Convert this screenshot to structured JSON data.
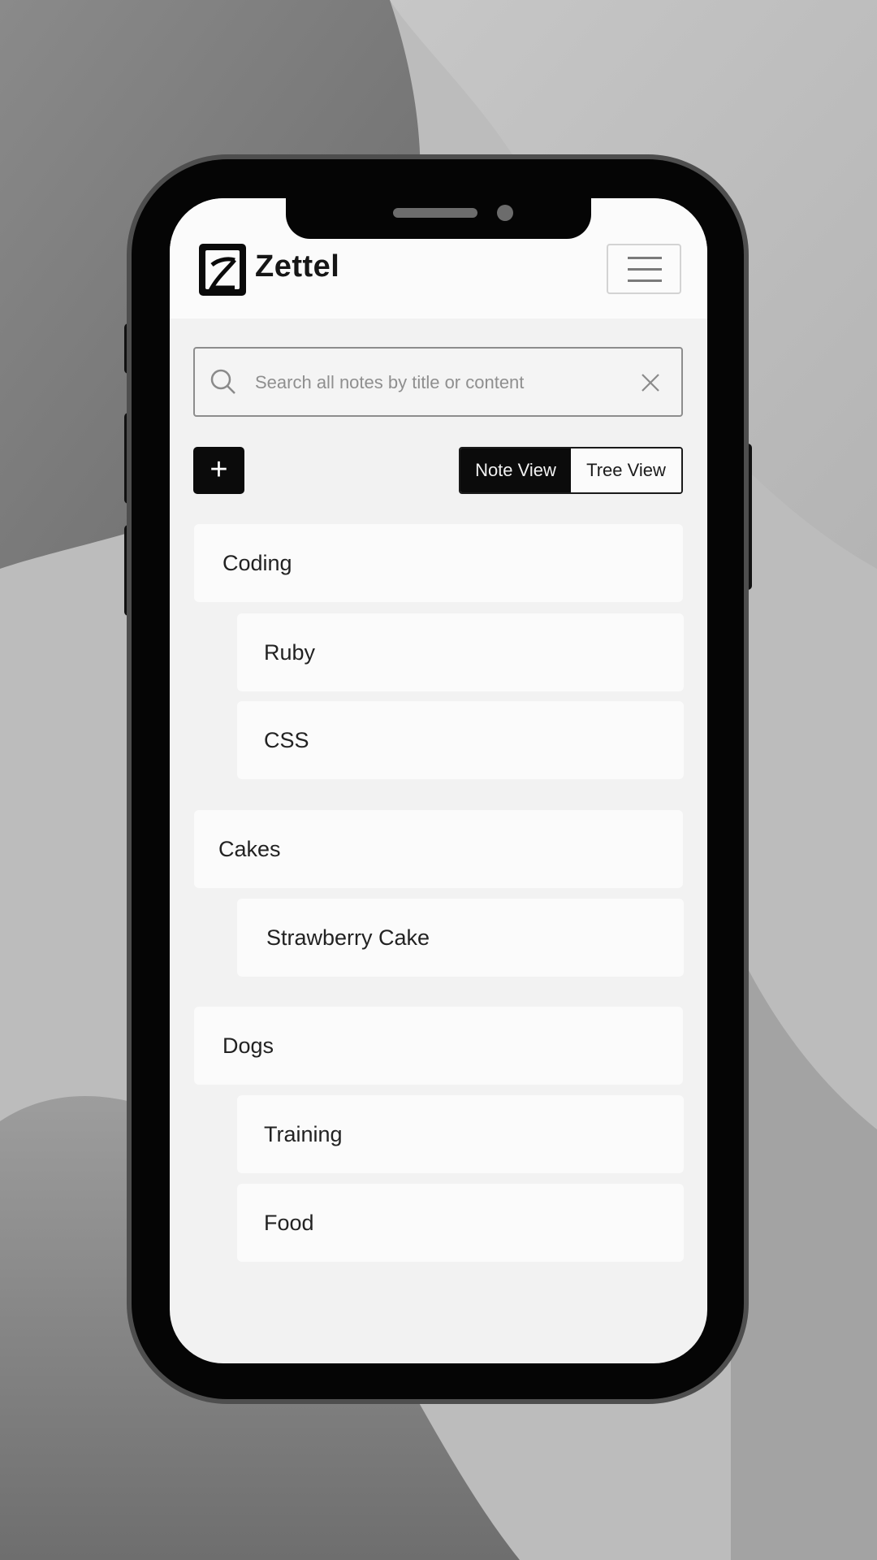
{
  "app": {
    "brand": "Zettel"
  },
  "search": {
    "placeholder": "Search all notes by title or content"
  },
  "toolbar": {
    "add_label": "+",
    "view_toggle": {
      "options": [
        "Note View",
        "Tree View"
      ],
      "selected": "Note View"
    }
  },
  "notes": [
    {
      "title": "Coding",
      "children": [
        {
          "title": "Ruby"
        },
        {
          "title": "CSS"
        }
      ]
    },
    {
      "title": "Cakes",
      "children": [
        {
          "title": "Strawberry Cake"
        }
      ]
    },
    {
      "title": "Dogs",
      "children": [
        {
          "title": "Training"
        },
        {
          "title": "Food"
        }
      ]
    }
  ],
  "icons": {
    "logo": "zettel-logo-icon",
    "menu": "hamburger-menu-icon",
    "search": "search-icon",
    "clear": "close-icon"
  }
}
